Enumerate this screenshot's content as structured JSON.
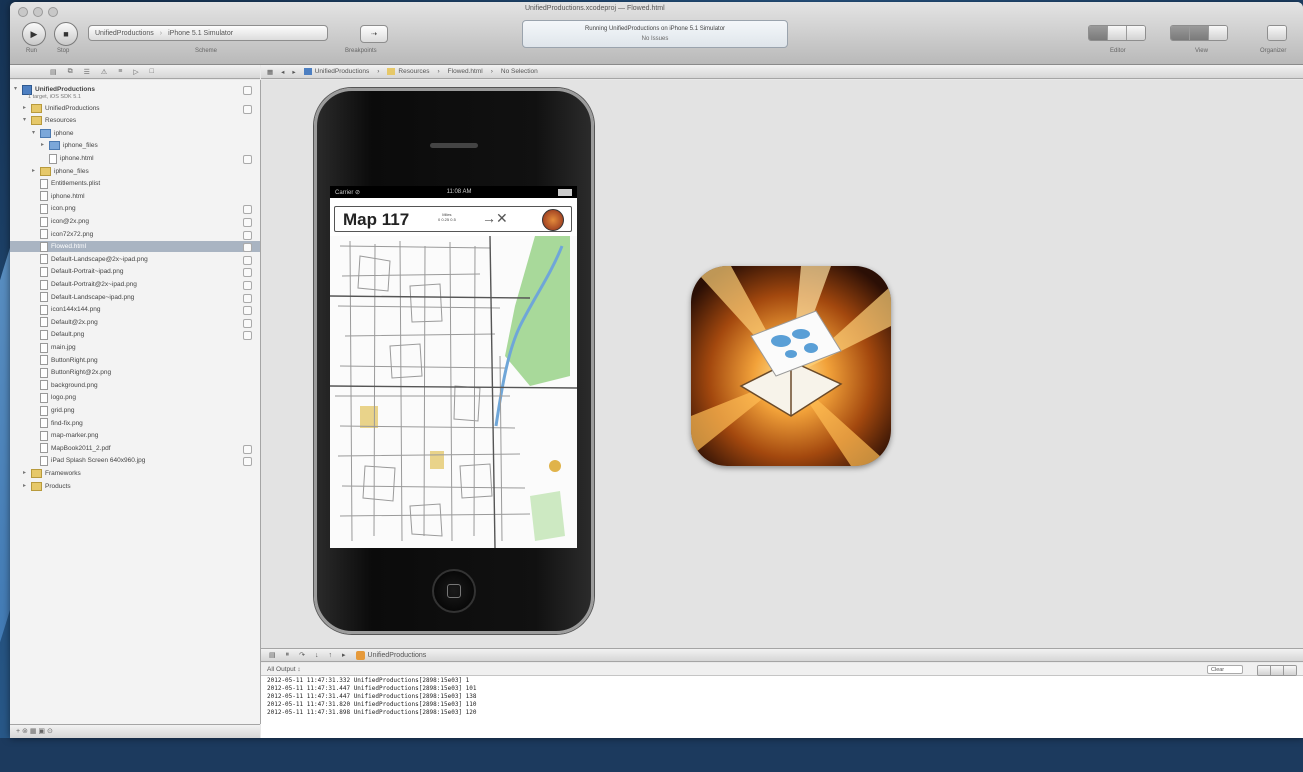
{
  "toolbar": {
    "window_title": "UnifiedProductions.xcodeproj — Flowed.html",
    "run_label": "Run",
    "stop_label": "Stop",
    "scheme_target": "UnifiedProductions",
    "scheme_device": "iPhone 5.1 Simulator",
    "scheme_label": "Scheme",
    "breakpoints_label": "Breakpoints",
    "breakpoints_btn": "⇢",
    "activity_line1": "Running UnifiedProductions on iPhone 5.1 Simulator",
    "activity_line2": "No Issues",
    "editor_label": "Editor",
    "view_label": "View",
    "organizer_label": "Organizer"
  },
  "navigator": {
    "tabs": [
      "▤",
      "⧉",
      "☰",
      "⚠",
      "≡",
      "▷",
      "□"
    ],
    "items": [
      {
        "label": "UnifiedProductions",
        "sub": "1 target, iOS SDK 5.1",
        "type": "proj",
        "depth": 0,
        "tri": "▾",
        "badge": true
      },
      {
        "label": "UnifiedProductions",
        "type": "folder",
        "depth": 1,
        "tri": "▸",
        "badge": true
      },
      {
        "label": "Resources",
        "type": "folder",
        "depth": 1,
        "tri": "▾",
        "badge": false
      },
      {
        "label": "iphone",
        "type": "folder-blue",
        "depth": 2,
        "tri": "▾",
        "badge": false
      },
      {
        "label": "iphone_files",
        "type": "folder-blue",
        "depth": 3,
        "tri": "▸",
        "badge": false
      },
      {
        "label": "iphone.html",
        "type": "file",
        "depth": 3,
        "tri": "",
        "badge": true
      },
      {
        "label": "iphone_files",
        "type": "folder",
        "depth": 2,
        "tri": "▸",
        "badge": false
      },
      {
        "label": "Entitlements.plist",
        "type": "file",
        "depth": 2,
        "tri": "",
        "badge": false
      },
      {
        "label": "iphone.html",
        "type": "file",
        "depth": 2,
        "tri": "",
        "badge": false
      },
      {
        "label": "icon.png",
        "type": "file",
        "depth": 2,
        "tri": "",
        "badge": true
      },
      {
        "label": "icon@2x.png",
        "type": "file",
        "depth": 2,
        "tri": "",
        "badge": true
      },
      {
        "label": "icon72x72.png",
        "type": "file",
        "depth": 2,
        "tri": "",
        "badge": true
      },
      {
        "label": "Flowed.html",
        "type": "file",
        "depth": 2,
        "tri": "",
        "badge": true,
        "selected": true
      },
      {
        "label": "Default-Landscape@2x~ipad.png",
        "type": "file",
        "depth": 2,
        "tri": "",
        "badge": true
      },
      {
        "label": "Default-Portrait~ipad.png",
        "type": "file",
        "depth": 2,
        "tri": "",
        "badge": true
      },
      {
        "label": "Default-Portrait@2x~ipad.png",
        "type": "file",
        "depth": 2,
        "tri": "",
        "badge": true
      },
      {
        "label": "Default-Landscape~ipad.png",
        "type": "file",
        "depth": 2,
        "tri": "",
        "badge": true
      },
      {
        "label": "icon144x144.png",
        "type": "file",
        "depth": 2,
        "tri": "",
        "badge": true
      },
      {
        "label": "Default@2x.png",
        "type": "file",
        "depth": 2,
        "tri": "",
        "badge": true
      },
      {
        "label": "Default.png",
        "type": "file",
        "depth": 2,
        "tri": "",
        "badge": true
      },
      {
        "label": "main.jpg",
        "type": "file",
        "depth": 2,
        "tri": "",
        "badge": false
      },
      {
        "label": "ButtonRight.png",
        "type": "file",
        "depth": 2,
        "tri": "",
        "badge": false
      },
      {
        "label": "ButtonRight@2x.png",
        "type": "file",
        "depth": 2,
        "tri": "",
        "badge": false
      },
      {
        "label": "background.png",
        "type": "file",
        "depth": 2,
        "tri": "",
        "badge": false
      },
      {
        "label": "logo.png",
        "type": "file",
        "depth": 2,
        "tri": "",
        "badge": false
      },
      {
        "label": "grid.png",
        "type": "file",
        "depth": 2,
        "tri": "",
        "badge": false
      },
      {
        "label": "find-fix.png",
        "type": "file",
        "depth": 2,
        "tri": "",
        "badge": false
      },
      {
        "label": "map-marker.png",
        "type": "file",
        "depth": 2,
        "tri": "",
        "badge": false
      },
      {
        "label": "MapBook2011_2.pdf",
        "type": "file",
        "depth": 2,
        "tri": "",
        "badge": true
      },
      {
        "label": "iPad Splash Screen 640x960.jpg",
        "type": "file",
        "depth": 2,
        "tri": "",
        "badge": true
      },
      {
        "label": "Frameworks",
        "type": "folder",
        "depth": 1,
        "tri": "▸",
        "badge": false
      },
      {
        "label": "Products",
        "type": "folder",
        "depth": 1,
        "tri": "▸",
        "badge": false
      }
    ],
    "footer": "+  ⊚  ▦  ▣  ⊙"
  },
  "jumpbar": {
    "controls": [
      "▦",
      "◂",
      "▸"
    ],
    "crumbs": [
      "UnifiedProductions",
      "Resources",
      "Flowed.html",
      "No Selection"
    ]
  },
  "simulator": {
    "carrier": "Carrier ⊘",
    "time": "11:08 AM",
    "map_title": "Map 117",
    "map_scale_line1": "Miles",
    "map_scale_line2": "0  0.25  0.5",
    "compass": "→✕"
  },
  "debug": {
    "controls": [
      "▤",
      "⏸",
      "↷",
      "↓",
      "↑",
      "▸"
    ],
    "target": "UnifiedProductions",
    "console_title": "All Output ↕",
    "filter": "Clear",
    "lines": [
      "2012-05-11 11:47:31.332 UnifiedProductions[2898:15e03] 1",
      "2012-05-11 11:47:31.447 UnifiedProductions[2898:15e03] 101",
      "2012-05-11 11:47:31.447 UnifiedProductions[2898:15e03] 138",
      "2012-05-11 11:47:31.820 UnifiedProductions[2898:15e03] 110",
      "2012-05-11 11:47:31.898 UnifiedProductions[2898:15e03] 120"
    ]
  },
  "colors": {
    "accent": "#4d7fc1",
    "selection": "#a9b4c2",
    "park_green": "#a8d99a",
    "water_blue": "#6fa6d8"
  }
}
